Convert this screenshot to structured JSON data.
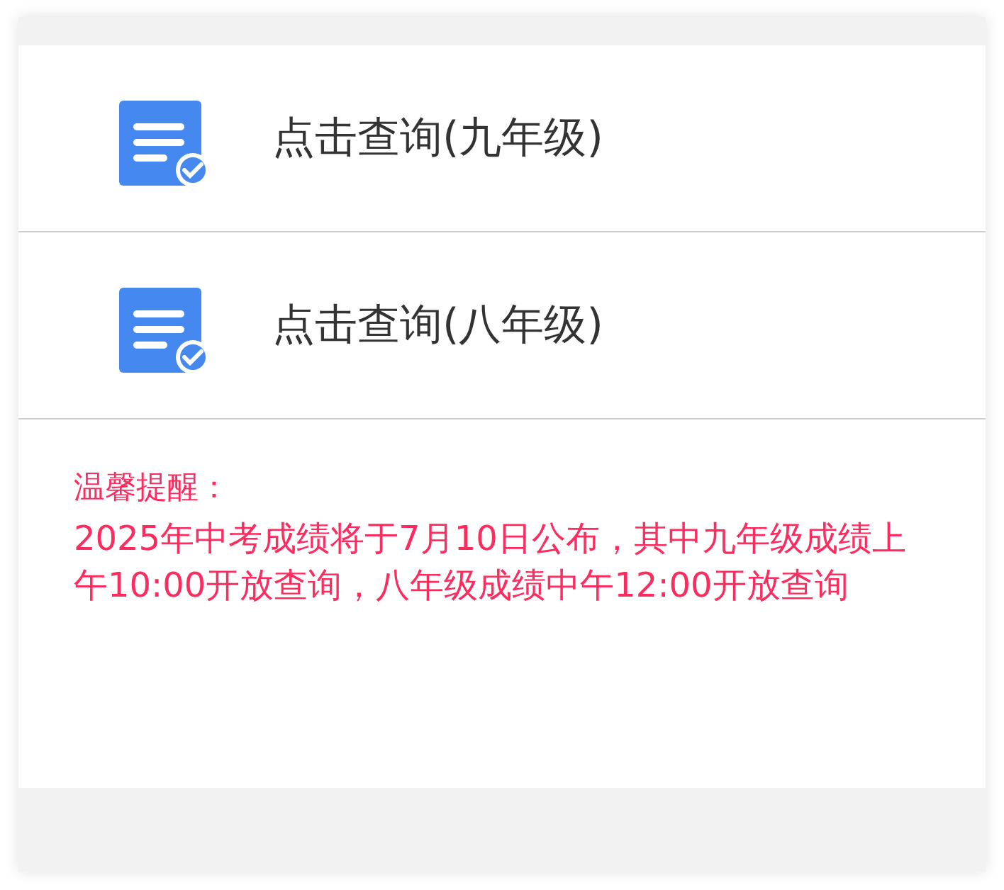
{
  "query_items": [
    {
      "label": "点击查询(九年级)"
    },
    {
      "label": "点击查询(八年级)"
    }
  ],
  "notice": {
    "title": "温馨提醒：",
    "body": "2025年中考成绩将于7月10日公布，其中九年级成绩上午10:00开放查询，八年级成绩中午12:00开放查询"
  }
}
